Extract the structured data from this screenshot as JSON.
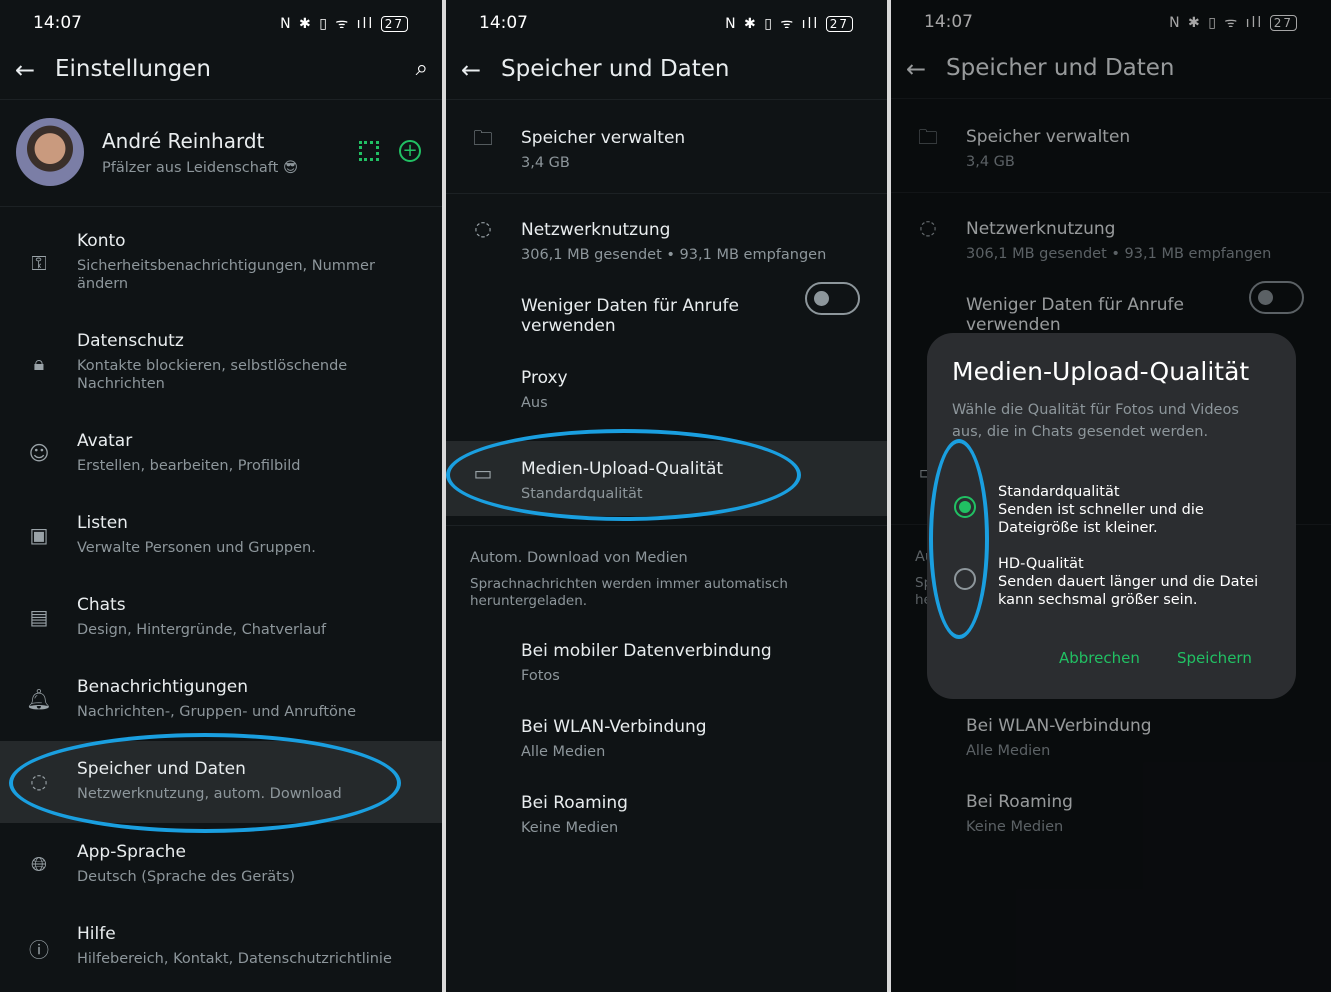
{
  "status": {
    "time": "14:07",
    "icons": "N ✱ ▯ ᯤ ıll",
    "battery": "27"
  },
  "settings": {
    "title": "Einstellungen",
    "profile": {
      "name": "André Reinhardt",
      "status": "Pfälzer aus Leidenschaft 😎"
    },
    "items": [
      {
        "title": "Konto",
        "sub": "Sicherheitsbenachrichtigungen, Nummer ändern",
        "icon": "key-icon",
        "glyph": "⚿"
      },
      {
        "title": "Datenschutz",
        "sub": "Kontakte blockieren, selbstlöschende Nachrichten",
        "icon": "lock-icon",
        "glyph": "🔒︎"
      },
      {
        "title": "Avatar",
        "sub": "Erstellen, bearbeiten, Profilbild",
        "icon": "avatar-icon",
        "glyph": "☺"
      },
      {
        "title": "Listen",
        "sub": "Verwalte Personen und Gruppen.",
        "icon": "lists-icon",
        "glyph": "▣"
      },
      {
        "title": "Chats",
        "sub": "Design, Hintergründe, Chatverlauf",
        "icon": "chat-icon",
        "glyph": "▤"
      },
      {
        "title": "Benachrichtigungen",
        "sub": "Nachrichten-, Gruppen- und Anruftöne",
        "icon": "bell-icon",
        "glyph": "🔔︎"
      },
      {
        "title": "Speicher und Daten",
        "sub": "Netzwerknutzung, autom. Download",
        "icon": "storage-icon",
        "glyph": "◌"
      },
      {
        "title": "App-Sprache",
        "sub": "Deutsch (Sprache des Geräts)",
        "icon": "globe-icon",
        "glyph": "🌐︎"
      },
      {
        "title": "Hilfe",
        "sub": "Hilfebereich, Kontakt, Datenschutzrichtlinie",
        "icon": "help-icon",
        "glyph": "ⓘ"
      }
    ]
  },
  "storage": {
    "title": "Speicher und Daten",
    "items": [
      {
        "title": "Speicher verwalten",
        "sub": "3,4 GB",
        "icon": "folder-icon",
        "glyph": "🗀"
      },
      {
        "title": "Netzwerknutzung",
        "sub": "306,1 MB gesendet • 93,1 MB empfangen",
        "icon": "data-usage-icon",
        "glyph": "◌"
      },
      {
        "title": "Weniger Daten für Anrufe verwenden",
        "sub": "",
        "toggle": false
      },
      {
        "title": "Proxy",
        "sub": "Aus"
      },
      {
        "title": "Medien-Upload-Qualität",
        "sub": "Standardqualität",
        "icon": "hd-icon",
        "glyph": "▭"
      }
    ],
    "section": {
      "title": "Autom. Download von Medien",
      "desc": "Sprachnachrichten werden immer automatisch heruntergeladen."
    },
    "downloads": [
      {
        "title": "Bei mobiler Datenverbindung",
        "sub": "Fotos"
      },
      {
        "title": "Bei WLAN-Verbindung",
        "sub": "Alle Medien"
      },
      {
        "title": "Bei Roaming",
        "sub": "Keine Medien"
      }
    ]
  },
  "dialog": {
    "title": "Medien-Upload-Qualität",
    "desc": "Wähle die Qualität für Fotos und Videos aus, die in Chats gesendet werden.",
    "options": [
      {
        "title": "Standardqualität",
        "desc": "Senden ist schneller und die Dateigröße ist kleiner.",
        "selected": true
      },
      {
        "title": "HD-Qualität",
        "desc": "Senden dauert länger und die Datei kann sechsmal größer sein.",
        "selected": false
      }
    ],
    "cancel": "Abbrechen",
    "save": "Speichern"
  },
  "colors": {
    "accent": "#21c063",
    "annotation": "#1a9fe0",
    "background": "#0f1315"
  }
}
